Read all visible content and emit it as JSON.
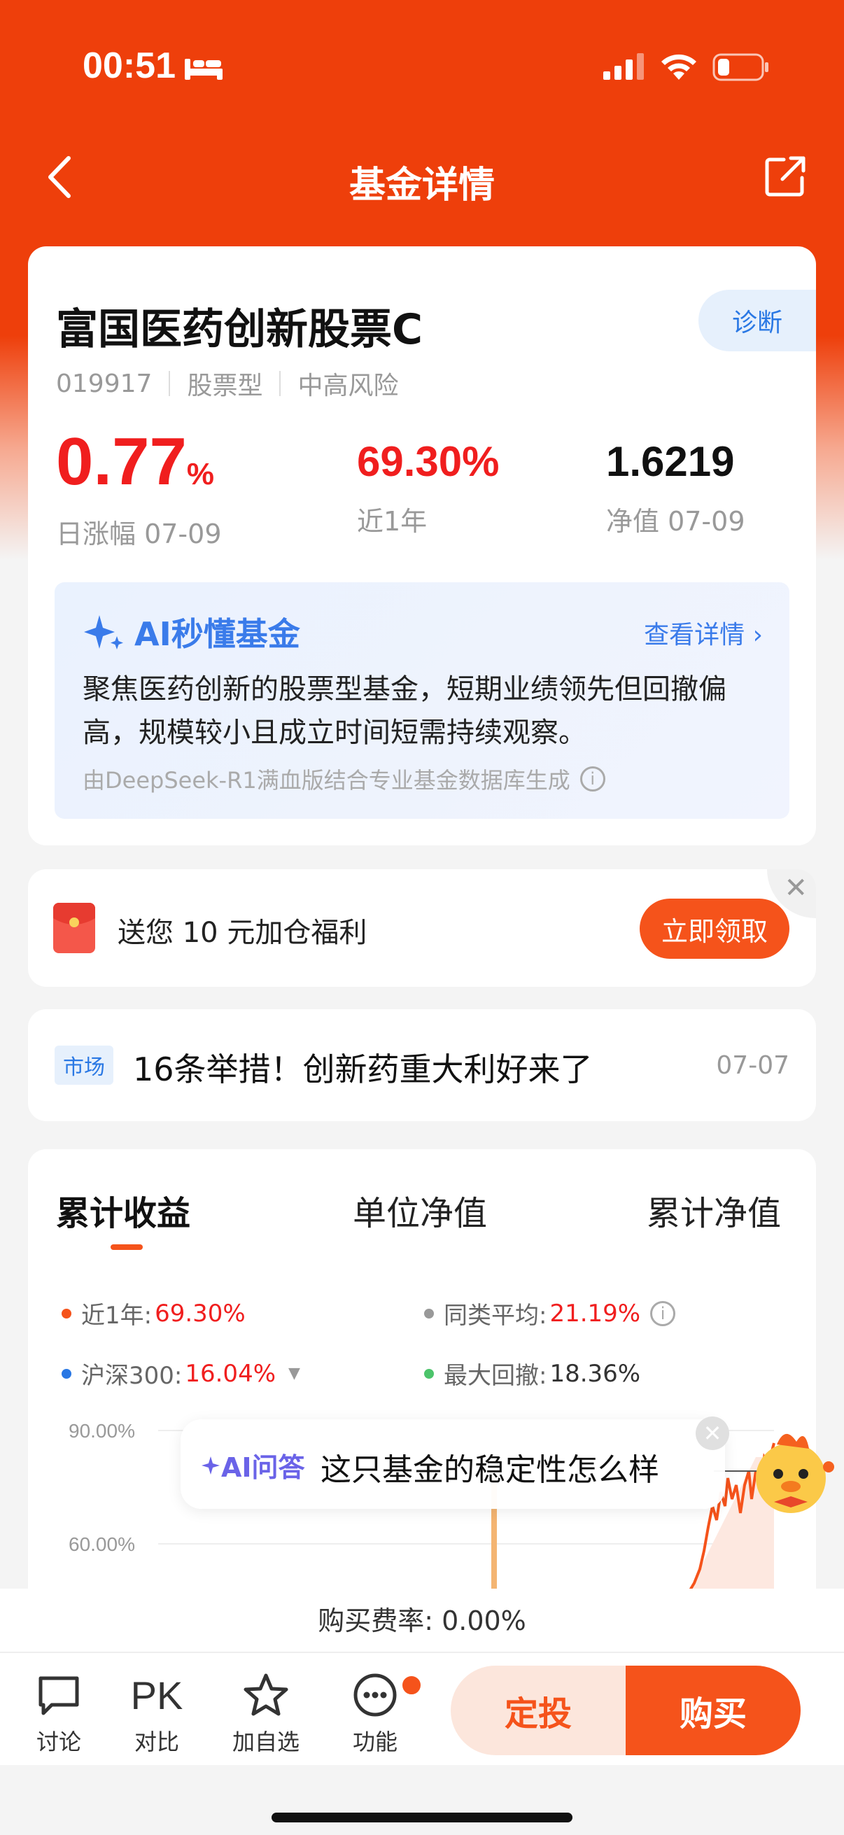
{
  "status_bar": {
    "time": "00:51"
  },
  "nav": {
    "title": "基金详情"
  },
  "fund": {
    "name": "富国医药创新股票C",
    "diagnose_label": "诊断",
    "code": "019917",
    "type": "股票型",
    "risk": "中高风险",
    "daily_change": "0.77",
    "daily_change_unit": "%",
    "daily_change_label": "日涨幅 07-09",
    "one_year_return": "69.30%",
    "one_year_label": "近1年",
    "nav_value": "1.6219",
    "nav_label": "净值 07-09"
  },
  "ai_summary": {
    "title": "AI秒懂基金",
    "link": "查看详情 ›",
    "text": "聚焦医药创新的股票型基金，短期业绩领先但回撤偏高，规模较小且成立时间短需持续观察。",
    "source": "由DeepSeek-R1满血版结合专业基金数据库生成"
  },
  "promo": {
    "text": "送您 10 元加仓福利",
    "button": "立即领取"
  },
  "news": {
    "tag": "市场",
    "title": "16条举措！创新药重大利好来了",
    "date": "07-07"
  },
  "chart_tabs": [
    "累计收益",
    "单位净值",
    "累计净值"
  ],
  "legend": {
    "one_year_label": "近1年:",
    "one_year_value": "69.30%",
    "peer_avg_label": "同类平均:",
    "peer_avg_value": "21.19%",
    "hs300_label": "沪深300:",
    "hs300_value": "16.04%",
    "max_drawdown_label": "最大回撤:",
    "max_drawdown_value": "18.36%"
  },
  "chart_data": {
    "type": "line",
    "y_ticks": [
      "90.00%",
      "60.00%"
    ],
    "ylim_visible": [
      60,
      90
    ],
    "series": [
      {
        "name": "近1年",
        "color": "#f5531b"
      },
      {
        "name": "同类平均",
        "color": "#999999"
      },
      {
        "name": "沪深300",
        "color": "#2a78e4"
      }
    ]
  },
  "ai_bubble": {
    "tag": "AI问答",
    "question": "这只基金的稳定性怎么样"
  },
  "fee": {
    "text": "购买费率:  0.00%"
  },
  "bottom_nav": {
    "discuss": "讨论",
    "pk_glyph": "PK",
    "compare": "对比",
    "watchlist": "加自选",
    "features": "功能",
    "auto_invest": "定投",
    "buy": "购买"
  },
  "colors": {
    "brand": "#ee3f0b",
    "accent": "#f5531b",
    "up": "#f01e1e",
    "link": "#2a78e4"
  }
}
